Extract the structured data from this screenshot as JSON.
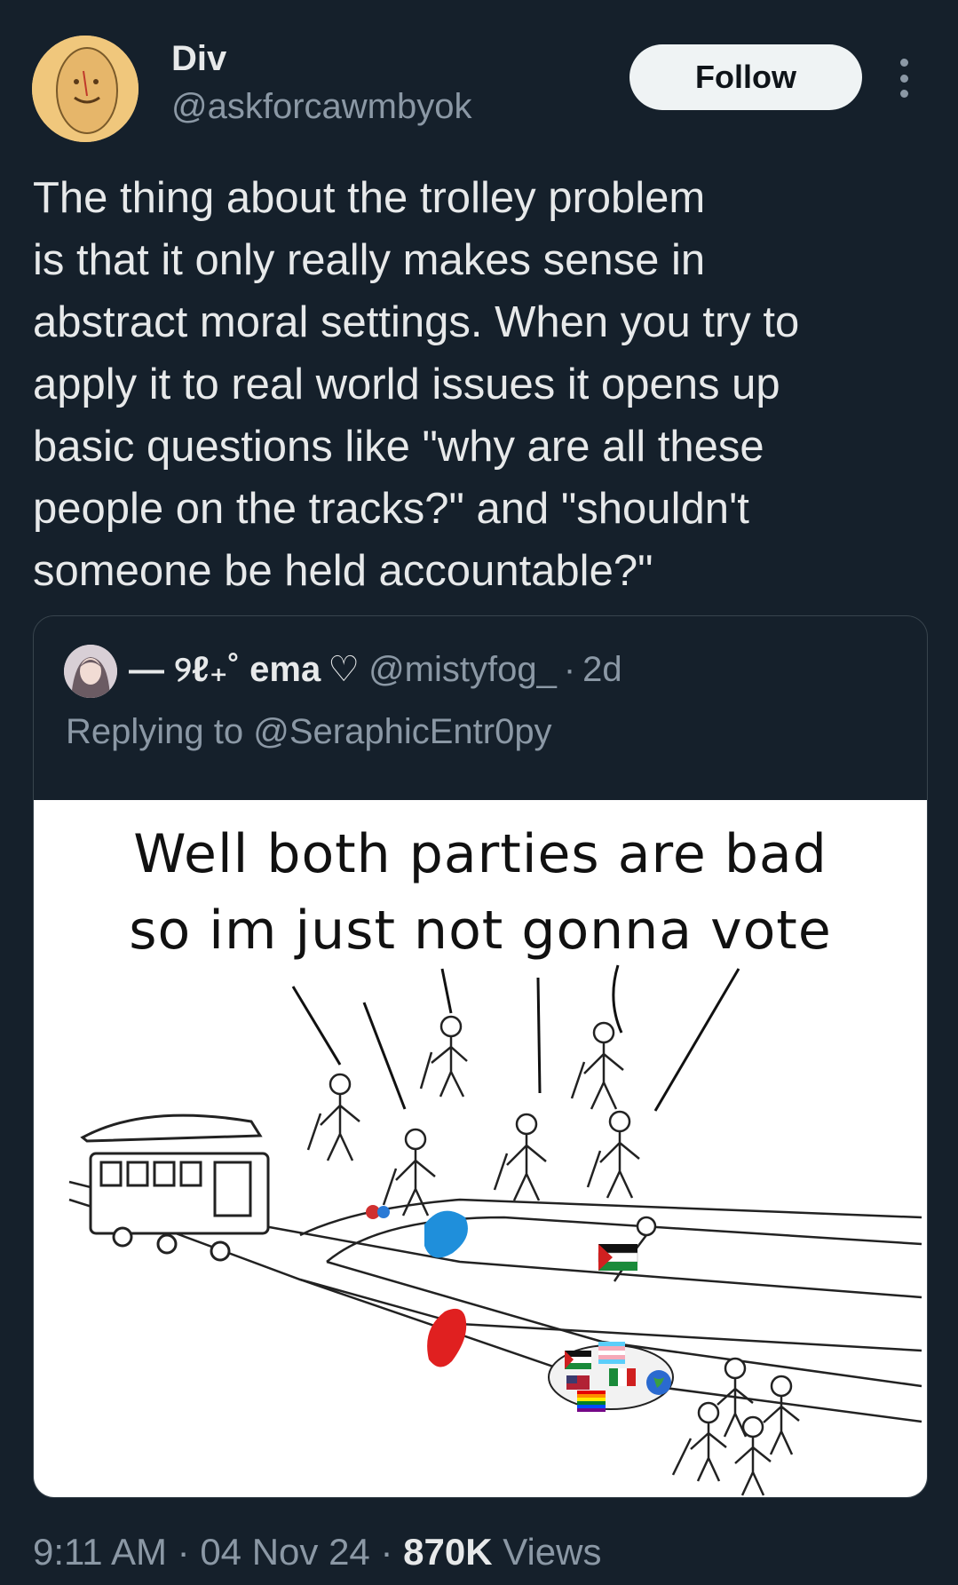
{
  "tweet": {
    "author_name": "Div",
    "author_handle": "@askforcawmbyok",
    "follow_label": "Follow",
    "text": "The thing about the trolley problem\nis that it only really makes sense in\nabstract moral settings. When you try to\napply it to real world issues it opens up\nbasic questions like \"why are all these\npeople on the tracks?\" and \"shouldn't\nsomeone be held accountable?\""
  },
  "quoted": {
    "display_name": "— ୨ℓ₊˚ ema",
    "heart": "♡",
    "handle": "@mistyfog_",
    "separator": "·",
    "time": "2d",
    "replying_to": "Replying to @SeraphicEntr0py",
    "meme_caption": "Well both parties are bad\nso im just not gonna vote"
  },
  "footer": {
    "time": "9:11 AM",
    "date": "04 Nov 24",
    "separator": "·",
    "views_count": "870K",
    "views_label": "Views"
  },
  "icons": {
    "more": "more-vertical-icon",
    "heart": "heart-outline-icon"
  },
  "colors": {
    "background": "#15202b",
    "text_primary": "#e7e9ea",
    "text_secondary": "#8b98a5",
    "follow_bg": "#eff3f4",
    "border": "#38444d"
  }
}
